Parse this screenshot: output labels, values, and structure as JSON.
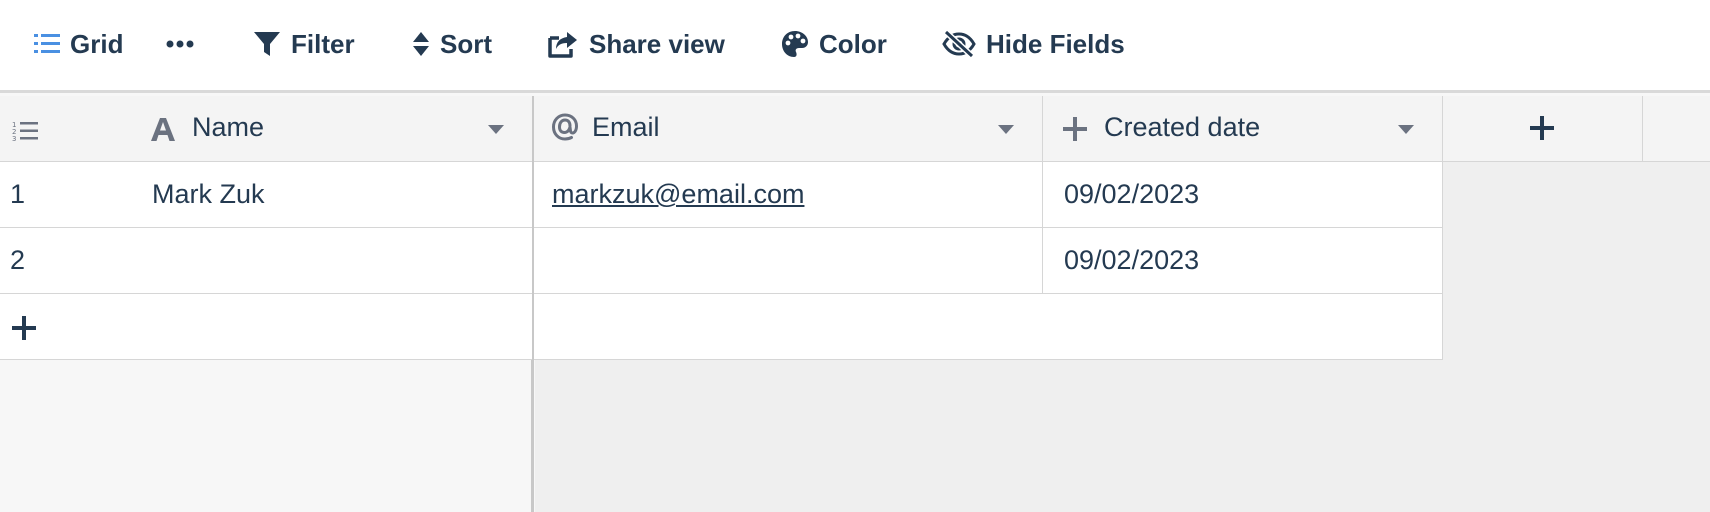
{
  "toolbar": {
    "grid_label": "Grid",
    "filter_label": "Filter",
    "sort_label": "Sort",
    "share_label": "Share view",
    "color_label": "Color",
    "hide_fields_label": "Hide Fields",
    "icons": [
      "hamburger-icon",
      "more-icon",
      "filter-icon",
      "sort-icon",
      "share-icon",
      "palette-icon",
      "eye-slash-icon"
    ]
  },
  "table": {
    "columns": [
      {
        "label": "Name",
        "icon": "text-type-icon"
      },
      {
        "label": "Email",
        "icon": "at-sign-icon"
      },
      {
        "label": "Created date",
        "icon": "plus-type-icon"
      }
    ],
    "rows": [
      {
        "count": "1",
        "name": "Mark Zuk",
        "email": "markzuk@email.com",
        "created": "09/02/2023"
      },
      {
        "count": "2",
        "name": "",
        "email": "",
        "created": "09/02/2023"
      }
    ]
  },
  "colors": {
    "accent": "#4a90e2",
    "text": "#243a51",
    "header_bg": "#f4f4f4",
    "cell_bg": "#ffffff",
    "grid_bg": "#f7f7f7"
  }
}
